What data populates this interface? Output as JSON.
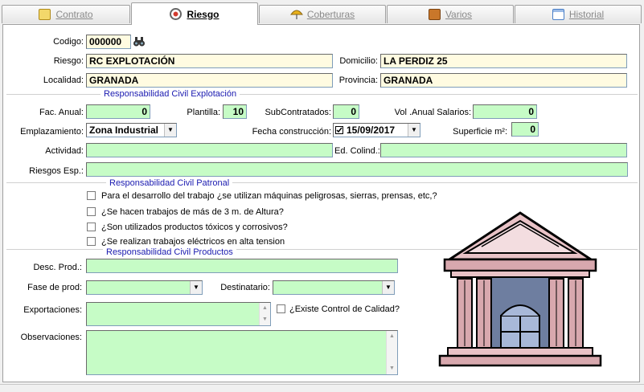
{
  "tabs": [
    {
      "label": "Contrato",
      "icon": "contract-icon",
      "color": "#f3c22c"
    },
    {
      "label": "Riesgo",
      "icon": "risk-icon",
      "color": "#d23b2f"
    },
    {
      "label": "Coberturas",
      "icon": "umbrella-icon",
      "color": "#e9b11b"
    },
    {
      "label": "Varios",
      "icon": "box-icon",
      "color": "#c9772a"
    },
    {
      "label": "Historial",
      "icon": "history-icon",
      "color": "#4a7fc8"
    }
  ],
  "form": {
    "codigo_label": "Codigo:",
    "codigo": "000000",
    "riesgo_label": "Riesgo:",
    "riesgo": "RC EXPLOTACIÓN",
    "domicilio_label": "Domicilio:",
    "domicilio": "LA PERDIZ 25",
    "localidad_label": "Localidad:",
    "localidad": "GRANADA",
    "provincia_label": "Provincia:",
    "provincia": "GRANADA"
  },
  "explotacion": {
    "title": "Responsabilidad Civil Explotación",
    "fac_label": "Fac. Anual:",
    "fac": "0",
    "plantilla_label": "Plantilla:",
    "plantilla": "10",
    "sub_label": "SubContratados:",
    "sub": "0",
    "vol_label": "Vol .Anual Salarios:",
    "vol": "0",
    "empl_label": "Emplazamiento:",
    "empl": "Zona Industrial",
    "fecha_label": "Fecha construcción:",
    "fecha": "15/09/2017",
    "superficie_label": "Superficie m²:",
    "superficie": "0",
    "actividad_label": "Actividad:",
    "colind_label": "Ed. Colind.:",
    "riesgos_label": "Riesgos Esp.:"
  },
  "patronal": {
    "title": "Responsabilidad Civil Patronal",
    "items": [
      "Para el desarrollo del trabajo ¿se utilizan máquinas peligrosas, sierras, prensas, etc,?",
      "¿Se hacen trabajos de más de 3 m. de Altura?",
      "¿Son utilizados productos tóxicos y corrosivos?",
      "¿Se realizan trabajos eléctricos en alta tension"
    ]
  },
  "productos": {
    "title": "Responsabilidad Civil Productos",
    "desc_label": "Desc. Prod.:",
    "fase_label": "Fase de prod:",
    "dest_label": "Destinatario:",
    "export_label": "Exportaciones:",
    "calidad_label": "¿Existe Control de Calidad?",
    "obs_label": "Observaciones:"
  },
  "image": {
    "icon": "building-icon"
  }
}
